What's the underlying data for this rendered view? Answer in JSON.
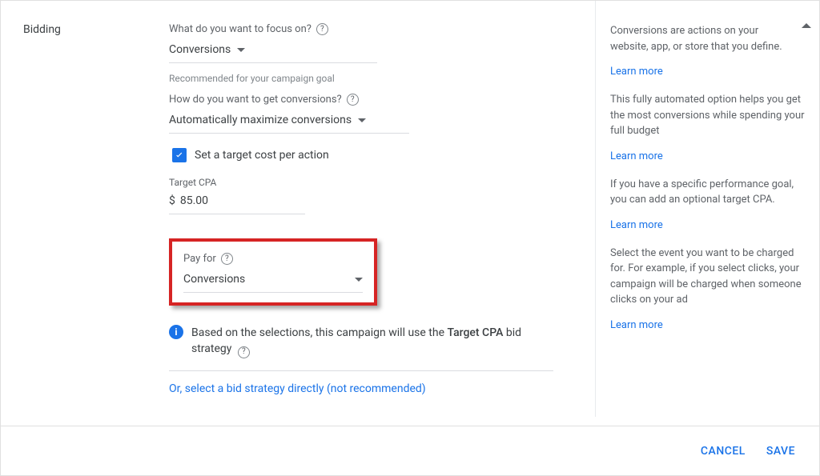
{
  "section": {
    "title": "Bidding"
  },
  "focus": {
    "label": "What do you want to focus on?",
    "value": "Conversions",
    "recommended": "Recommended for your campaign goal"
  },
  "method": {
    "label": "How do you want to get conversions?",
    "value": "Automatically maximize conversions"
  },
  "checkbox": {
    "label": "Set a target cost per action",
    "checked": true
  },
  "target_cpa": {
    "label": "Target CPA",
    "currency": "$",
    "value": "85.00"
  },
  "pay_for": {
    "label": "Pay for",
    "value": "Conversions"
  },
  "info": {
    "text_prefix": "Based on the selections, this campaign will use the ",
    "text_bold": "Target CPA",
    "text_suffix": " bid strategy"
  },
  "alt_link": "Or, select a bid strategy directly (not recommended)",
  "sidebar": {
    "block1": "Conversions are actions on your website, app, or store that you define.",
    "block2": "This fully automated option helps you get the most conversions while spending your full budget",
    "block3": "If you have a specific performance goal, you can add an optional target CPA.",
    "block4": "Select the event you want to be charged for. For example, if you select clicks, your campaign will be charged when someone clicks on your ad",
    "learn_more": "Learn more"
  },
  "footer": {
    "cancel": "Cancel",
    "save": "Save"
  }
}
